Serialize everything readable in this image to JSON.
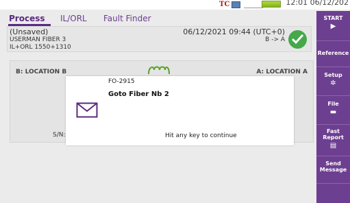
{
  "status_bar": {
    "time": "12:01 06/12/202",
    "icons": [
      "tc-logo-icon",
      "network-grid-icon",
      "cable-icon",
      "battery-icon"
    ]
  },
  "tabs": [
    {
      "label": "Process",
      "active": true
    },
    {
      "label": "IL/ORL",
      "active": false
    },
    {
      "label": "Fault Finder",
      "active": false
    }
  ],
  "info": {
    "state": "(Unsaved)",
    "fiber": "USERMAN FIBER 3",
    "measurement": "IL+ORL 1550+1310",
    "datetime": "06/12/2021 09:44 (UTC+0)",
    "direction": "B -> A",
    "result_icon": "check-icon"
  },
  "location": {
    "b_label": "B: LOCATION B",
    "a_label": "A: LOCATION A",
    "fiber_icon": "fiber-loop-icon",
    "sn_label": "S/N:"
  },
  "sidebar": [
    {
      "label": "START",
      "icon": "play-icon",
      "glyph": "▶"
    },
    {
      "label": "Reference",
      "icon": "",
      "glyph": ""
    },
    {
      "label": "Setup",
      "icon": "gear-icon",
      "glyph": "✲"
    },
    {
      "label": "File",
      "icon": "folder-icon",
      "glyph": "▬"
    },
    {
      "label": "Fast Report",
      "icon": "report-icon",
      "glyph": "▤"
    },
    {
      "label": "Send Message",
      "icon": "",
      "glyph": ""
    }
  ],
  "dialog": {
    "code": "FO-2915",
    "message": "Goto Fiber Nb 2",
    "hint": "Hit any key to continue",
    "icon": "envelope-icon"
  },
  "colors": {
    "accent": "#6d3f90",
    "success": "#45a84a",
    "background": "#ebebeb"
  }
}
